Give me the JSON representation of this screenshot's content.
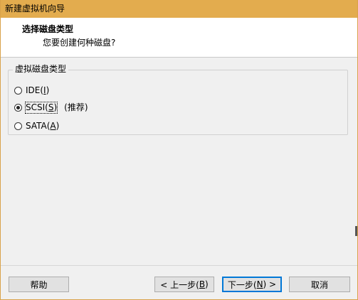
{
  "window": {
    "title": "新建虚拟机向导"
  },
  "header": {
    "title": "选择磁盘类型",
    "subtitle": "您要创建何种磁盘?"
  },
  "disk_type_group": {
    "legend": "虚拟磁盘类型",
    "options": [
      {
        "pre": "IDE(",
        "mnemonic": "I",
        "post": ")",
        "note": "",
        "checked": false
      },
      {
        "pre": "SCSI(",
        "mnemonic": "S",
        "post": ")",
        "note": "(推荐)",
        "checked": true
      },
      {
        "pre": "SATA(",
        "mnemonic": "A",
        "post": ")",
        "note": "",
        "checked": false
      }
    ]
  },
  "footer": {
    "help_label": "帮助",
    "back_pre": "< 上一步(",
    "back_mn": "B",
    "back_post": ")",
    "next_pre": "下一步(",
    "next_mn": "N",
    "next_post": ") >",
    "cancel_label": "取消"
  },
  "colors": {
    "titlebar": "#e3ac4e",
    "default_button_border": "#0078d7"
  }
}
